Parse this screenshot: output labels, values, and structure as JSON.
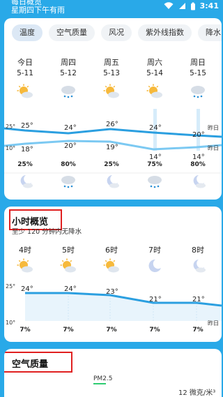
{
  "status": {
    "line1": "每日概览",
    "line2": "星期四下午有雨",
    "time": "3:41"
  },
  "tabs": [
    "温度",
    "空气质量",
    "风况",
    "紫外线指数",
    "降水"
  ],
  "days": [
    {
      "name": "今日",
      "date": "5-11",
      "high": "25°",
      "low": "18°",
      "rain": "25%",
      "day_icon": "sun-cloud-icon",
      "night_icon": "moon-cloud-icon"
    },
    {
      "name": "周四",
      "date": "5-12",
      "high": "24°",
      "low": "20°",
      "rain": "80%",
      "day_icon": "rain-cloud-icon",
      "night_icon": "rain-cloud-icon"
    },
    {
      "name": "周五",
      "date": "5-13",
      "high": "26°",
      "low": "19°",
      "rain": "25%",
      "day_icon": "sun-cloud-icon",
      "night_icon": "moon-cloud-icon"
    },
    {
      "name": "周六",
      "date": "5-14",
      "high": "24°",
      "low": "14°",
      "rain": "75%",
      "day_icon": "sun-cloud-icon",
      "night_icon": "rain-cloud-icon"
    },
    {
      "name": "周日",
      "date": "5-15",
      "high": "20°",
      "low": "14°",
      "rain": "80%",
      "day_icon": "rain-cloud-icon",
      "night_icon": "moon-cloud-icon"
    }
  ],
  "daily_axis": {
    "top": "25°",
    "bottom": "10°",
    "yesterday_hi": "昨日",
    "yesterday_lo": "昨日"
  },
  "hourly": {
    "title": "小时概览",
    "subtitle": "至少 120 分钟内无降水",
    "axis_top": "25°",
    "axis_bottom": "10°",
    "yesterday": "昨日",
    "hours": [
      {
        "label": "4时",
        "temp": "24°",
        "pct": "7%",
        "icon": "sun-cloud-icon"
      },
      {
        "label": "5时",
        "temp": "24°",
        "pct": "7%",
        "icon": "sun-cloud-icon"
      },
      {
        "label": "6时",
        "temp": "23°",
        "pct": "7%",
        "icon": "sun-cloud-icon"
      },
      {
        "label": "7时",
        "temp": "21°",
        "pct": "7%",
        "icon": "moon-icon"
      },
      {
        "label": "8时",
        "temp": "21°",
        "pct": "7%",
        "icon": "moon-cloud-icon"
      }
    ]
  },
  "air": {
    "title": "空气质量",
    "pm_label": "PM2.5",
    "value": "12 微克/米³"
  },
  "colors": {
    "background": "#29a9e8",
    "high_line": "#2b9fe0",
    "low_line": "#7cc9f2",
    "highlight_box": "#e02020"
  }
}
